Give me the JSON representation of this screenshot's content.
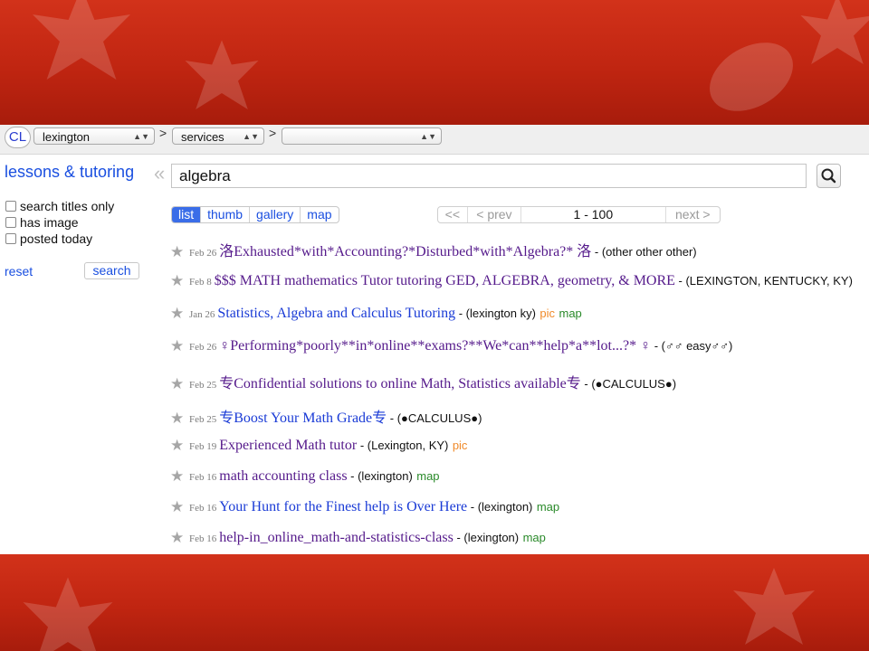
{
  "header": {
    "cl_label": "CL",
    "city": "lexington",
    "category": "services",
    "subcategory": "",
    "separator": ">"
  },
  "sidebar": {
    "category_title": "lessons & tutoring",
    "options": [
      "search titles only",
      "has image",
      "posted today"
    ],
    "reset_label": "reset",
    "search_label": "search"
  },
  "search": {
    "query": "algebra"
  },
  "views": [
    "list",
    "thumb",
    "gallery",
    "map"
  ],
  "pager": {
    "first": "<<",
    "prev": "< prev",
    "range": "1 - 100",
    "next": "next >"
  },
  "colors": {
    "accent": "#1a4fe0",
    "visited": "#551a8b",
    "pic": "#f08a2a",
    "map": "#2a8a2a",
    "background": "#c8290e"
  },
  "results": [
    {
      "date": "Feb 26",
      "title": "洛Exhausted*with*Accounting?*Disturbed*with*Algebra?* 洛",
      "loc": " - (other other other)",
      "pic": "",
      "map": "",
      "visited": true
    },
    {
      "date": "Feb 8",
      "title": "$$$ MATH mathematics Tutor tutoring GED, ALGEBRA, geometry, & MORE",
      "loc": " - (LEXINGTON, KENTUCKY, KY)",
      "pic": "",
      "map": "",
      "visited": true
    },
    {
      "date": "Jan 26",
      "title": "Statistics, Algebra and Calculus Tutoring",
      "loc": " - (lexington ky)",
      "pic": "pic",
      "map": "map",
      "visited": false
    },
    {
      "date": "Feb 26",
      "title": "♀Performing*poorly**in*online**exams?**We*can**help*a**lot...?* ♀",
      "loc": " - (♂♂ easy♂♂)",
      "pic": "",
      "map": "",
      "visited": true
    },
    {
      "date": "Feb 25",
      "title": "专Confidential solutions to online Math, Statistics available专",
      "loc": " - (●CALCULUS●)",
      "pic": "",
      "map": "",
      "visited": true
    },
    {
      "date": "Feb 25",
      "title": "专Boost Your Math Grade专",
      "loc": " - (●CALCULUS●)",
      "pic": "",
      "map": "",
      "visited": false
    },
    {
      "date": "Feb 19",
      "title": "Experienced Math tutor",
      "loc": " - (Lexington, KY)",
      "pic": "pic",
      "map": "",
      "visited": true
    },
    {
      "date": "Feb 16",
      "title": "math accounting class",
      "loc": " - (lexington)",
      "pic": "",
      "map": "map",
      "visited": true
    },
    {
      "date": "Feb 16",
      "title": "Your Hunt for the Finest help is Over Here",
      "loc": " - (lexington)",
      "pic": "",
      "map": "map",
      "visited": false
    },
    {
      "date": "Feb 16",
      "title": "help-in_online_math-and-statistics-class",
      "loc": " - (lexington)",
      "pic": "",
      "map": "map",
      "visited": true
    }
  ]
}
